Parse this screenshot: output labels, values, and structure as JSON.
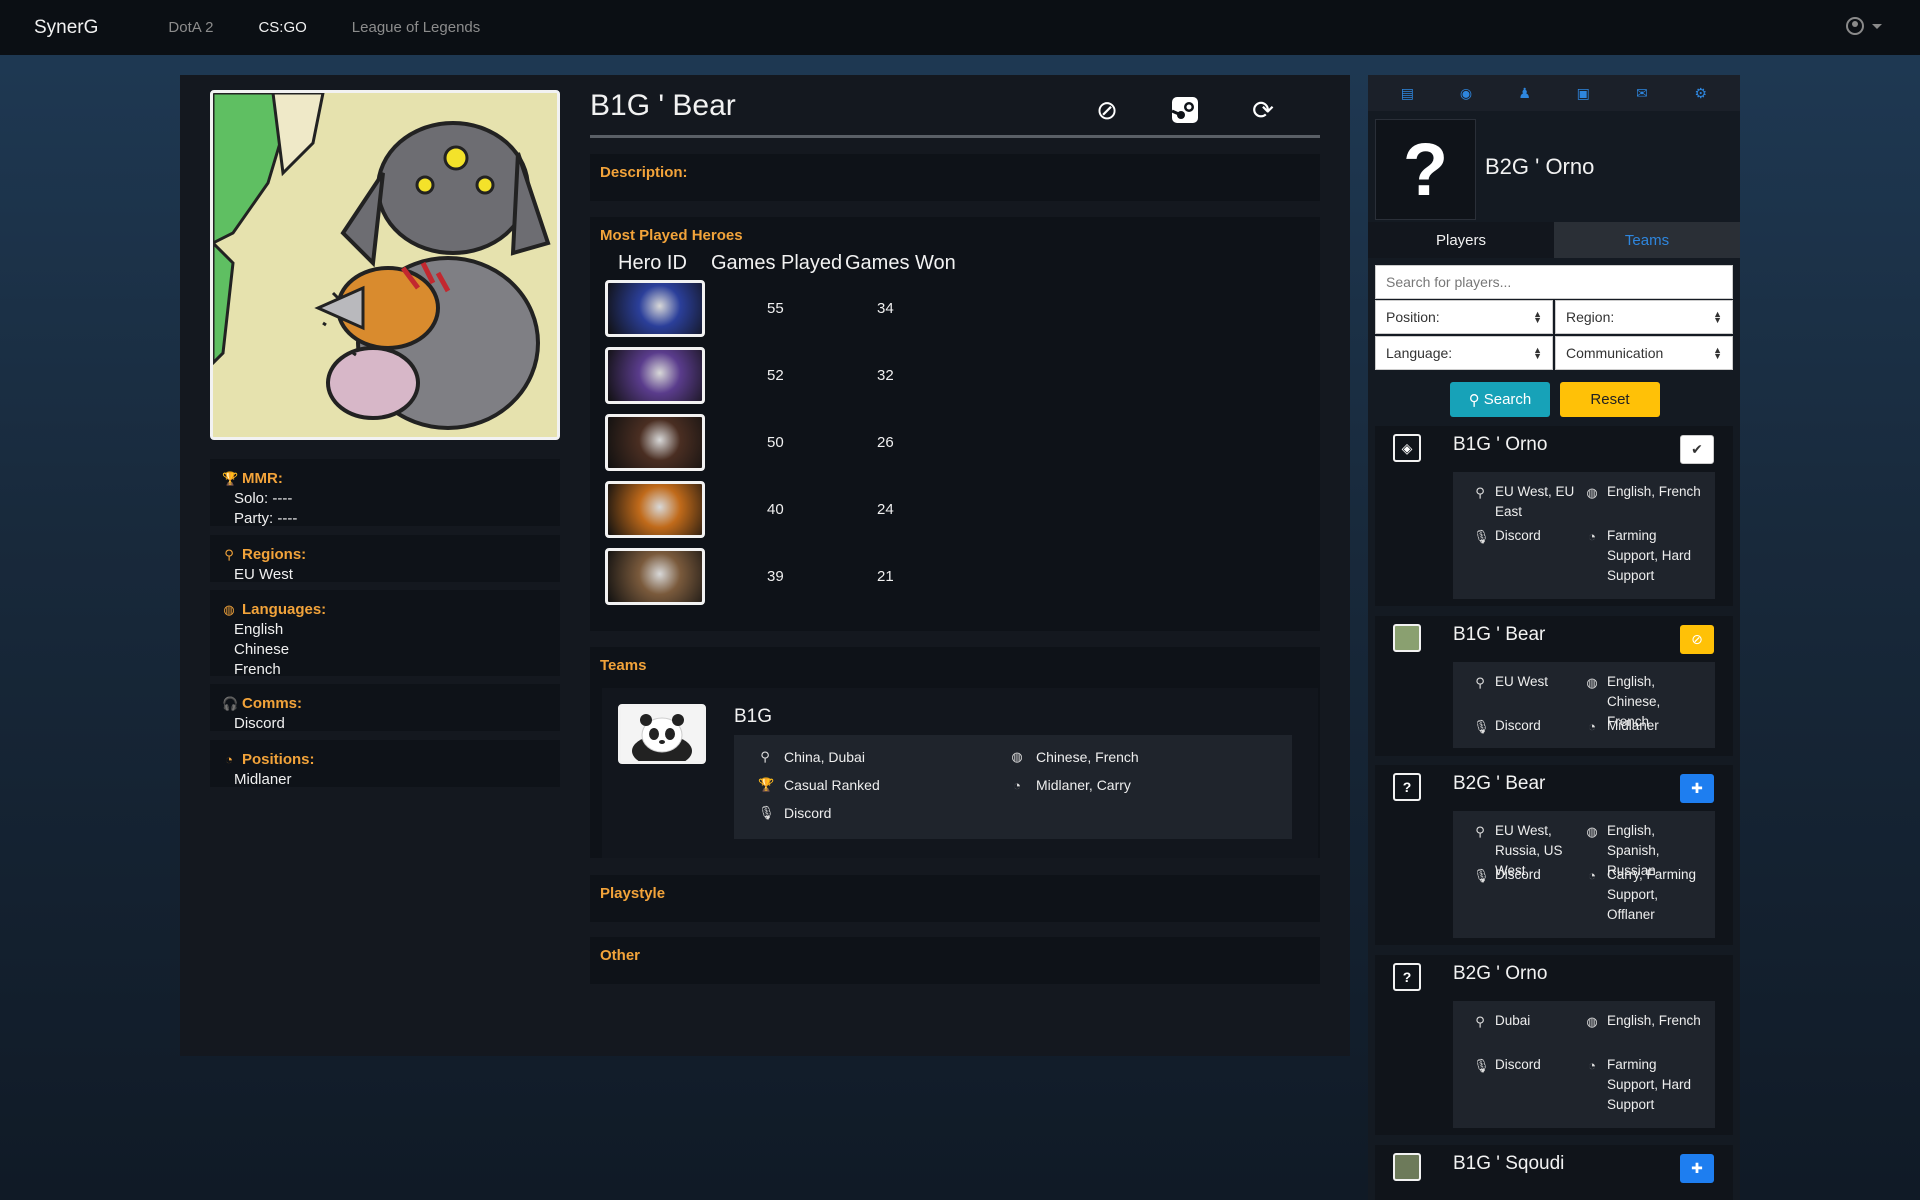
{
  "nav": {
    "brand": "SynerG",
    "links": [
      "DotA 2",
      "CS:GO",
      "League of Legends"
    ]
  },
  "player": {
    "name": "B1G ' Bear",
    "mmr_label": "MMR:",
    "solo": "Solo: ----",
    "party": "Party: ----",
    "regions_label": "Regions:",
    "regions": [
      "EU West"
    ],
    "languages_label": "Languages:",
    "languages": [
      "English",
      "Chinese",
      "French"
    ],
    "comms_label": "Comms:",
    "comms": "Discord",
    "positions_label": "Positions:",
    "positions": "Midlaner"
  },
  "description_label": "Description:",
  "heroes": {
    "title": "Most Played Heroes",
    "headers": [
      "Hero ID",
      "Games Played",
      "Games Won"
    ],
    "rows": [
      {
        "played": "55",
        "won": "34",
        "color": "#2b3f9a"
      },
      {
        "played": "52",
        "won": "32",
        "color": "#5a3c8c"
      },
      {
        "played": "50",
        "won": "26",
        "color": "#4a2e22"
      },
      {
        "played": "40",
        "won": "24",
        "color": "#c06a1a"
      },
      {
        "played": "39",
        "won": "21",
        "color": "#7a5a3c"
      }
    ]
  },
  "teams": {
    "title": "Teams",
    "team": {
      "name": "B1G",
      "location": "China, Dubai",
      "languages": "Chinese, French",
      "type": "Casual Ranked",
      "positions": "Midlaner, Carry",
      "comms": "Discord"
    }
  },
  "playstyle_label": "Playstyle",
  "other_label": "Other",
  "sidebar": {
    "selected_name": "B2G ' Orno",
    "tab_players": "Players",
    "tab_teams": "Teams",
    "search_placeholder": "Search for players...",
    "position_select": "Position:",
    "region_select": "Region:",
    "language_select": "Language:",
    "comms_select": "Communication",
    "search_button": "Search",
    "reset_button": "Reset",
    "results": [
      {
        "name": "B1G ' Orno",
        "region": "EU West, EU East",
        "langs": "English, French",
        "comms": "Discord",
        "positions": "Farming Support, Hard Support"
      },
      {
        "name": "B1G ' Bear",
        "region": "EU West",
        "langs": "English, Chinese, French",
        "comms": "Discord",
        "positions": "Midlaner"
      },
      {
        "name": "B2G ' Bear",
        "region": "EU West, Russia, US West",
        "langs": "English, Spanish, Russian",
        "comms": "Discord",
        "positions": "Carry, Farming Support, Offlaner"
      },
      {
        "name": "B2G ' Orno",
        "region": "Dubai",
        "langs": "English, French",
        "comms": "Discord",
        "positions": "Farming Support, Hard Support"
      },
      {
        "name": "B1G ' Sqoudi"
      }
    ]
  }
}
